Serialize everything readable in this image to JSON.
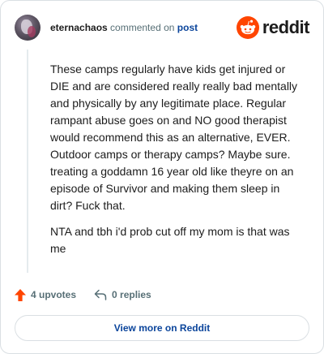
{
  "header": {
    "author": "eternachaos",
    "action_text": "commented on",
    "post_link": "post",
    "brand": "reddit"
  },
  "comment": {
    "paragraphs": [
      "These camps regularly have kids get injured or DIE and are considered really really bad mentally and physically by any legitimate place. Regular rampant abuse goes on and NO good therapist would recommend this as an alternative, EVER. Outdoor camps or therapy camps? Maybe sure. treating a goddamn 16 year old like theyre on an episode of Survivor and making them sleep in dirt? Fuck that.",
      "NTA and tbh i'd prob cut off my mom is that was me"
    ]
  },
  "footer": {
    "upvotes": "4 upvotes",
    "replies": "0 replies",
    "view_more": "View more on Reddit"
  },
  "colors": {
    "brand_orange": "#ff4500",
    "link_blue": "#0a449b",
    "muted_text": "#576f76"
  }
}
